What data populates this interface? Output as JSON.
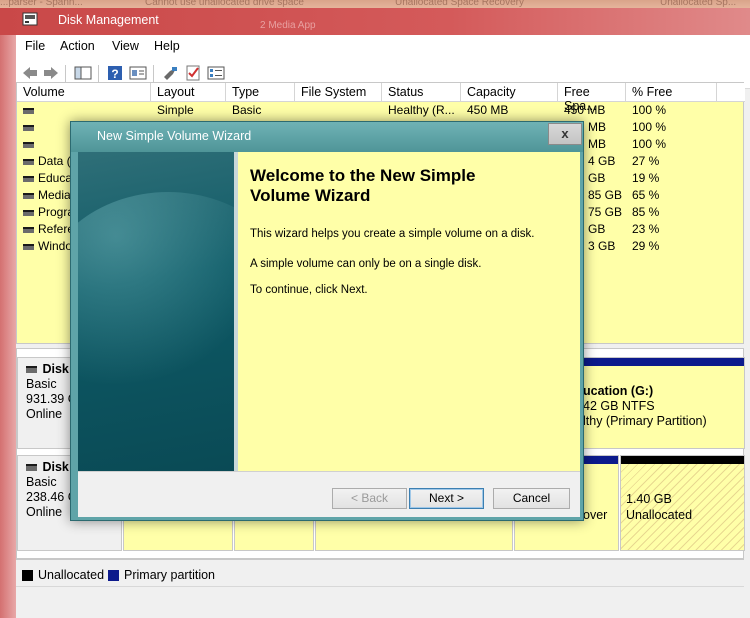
{
  "browser_tabs": [
    "...parser - Spann...",
    "Cannot use unallocated drive space",
    "Unallocated Space Recovery",
    "Unallocated Sp..."
  ],
  "window": {
    "title": "Disk Management",
    "ghost_text": "2 Media App"
  },
  "menu": [
    "File",
    "Action",
    "View",
    "Help"
  ],
  "toolbar_icons": [
    "back-arrow-icon",
    "forward-arrow-icon",
    "console-tree-icon",
    "help-icon",
    "properties-icon",
    "connect-icon",
    "checklist-icon",
    "settings-list-icon"
  ],
  "volume_list": {
    "columns": [
      "Volume",
      "Layout",
      "Type",
      "File System",
      "Status",
      "Capacity",
      "Free Spa...",
      "% Free"
    ],
    "rows": [
      {
        "volume": "",
        "layout": "Simple",
        "type": "Basic",
        "fs": "",
        "status": "Healthy (R...",
        "capacity": "450 MB",
        "free": "450 MB",
        "pct": "100 %"
      },
      {
        "volume": "",
        "layout": "",
        "type": "",
        "fs": "",
        "status": "",
        "capacity": "",
        "free": "MB",
        "pct": "100 %"
      },
      {
        "volume": "",
        "layout": "",
        "type": "",
        "fs": "",
        "status": "",
        "capacity": "",
        "free": "MB",
        "pct": "100 %"
      },
      {
        "volume": "Data (",
        "layout": "",
        "type": "",
        "fs": "",
        "status": "",
        "capacity": "",
        "free": "4 GB",
        "pct": "27 %"
      },
      {
        "volume": "Educa",
        "layout": "",
        "type": "",
        "fs": "",
        "status": "",
        "capacity": "",
        "free": "GB",
        "pct": "19 %"
      },
      {
        "volume": "Media",
        "layout": "",
        "type": "",
        "fs": "",
        "status": "",
        "capacity": "",
        "free": "85 GB",
        "pct": "65 %"
      },
      {
        "volume": "Progra",
        "layout": "",
        "type": "",
        "fs": "",
        "status": "",
        "capacity": "",
        "free": "75 GB",
        "pct": "85 %"
      },
      {
        "volume": "Refere",
        "layout": "",
        "type": "",
        "fs": "",
        "status": "",
        "capacity": "",
        "free": "GB",
        "pct": "23 %"
      },
      {
        "volume": "Windo",
        "layout": "",
        "type": "",
        "fs": "",
        "status": "",
        "capacity": "",
        "free": "3 GB",
        "pct": "29 %"
      }
    ]
  },
  "disks": [
    {
      "name": "Disk",
      "type": "Basic",
      "size": "931.39 G",
      "state": "Online"
    },
    {
      "name": "Disk",
      "type": "Basic",
      "size": "238.46 G",
      "state": "Online"
    }
  ],
  "partitions": {
    "education": {
      "line1": "ucation  (G:)",
      "line2": "42 GB NTFS",
      "line3": "lthy (Primary Partition)"
    },
    "recover": {
      "line1": "over"
    },
    "unallocated": {
      "size": "1.40 GB",
      "label": "Unallocated"
    }
  },
  "legend": [
    {
      "label": "Unallocated",
      "color": "#000000"
    },
    {
      "label": "Primary partition",
      "color": "#0c1a8c"
    }
  ],
  "wizard": {
    "title": "New Simple Volume Wizard",
    "close": "x",
    "heading": "Welcome to the New Simple Volume Wizard",
    "line1": "This wizard helps you create a simple volume on a disk.",
    "line2": "A simple volume can only be on a single disk.",
    "line3": "To continue, click Next.",
    "buttons": {
      "back": "< Back",
      "next": "Next >",
      "cancel": "Cancel"
    }
  }
}
